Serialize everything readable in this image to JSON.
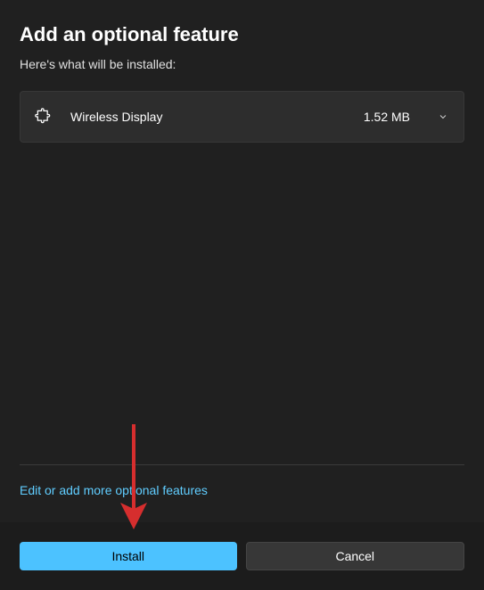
{
  "dialog": {
    "title": "Add an optional feature",
    "subtitle": "Here's what will be installed:"
  },
  "features": [
    {
      "name": "Wireless Display",
      "size": "1.52 MB"
    }
  ],
  "link": {
    "edit_label": "Edit or add more optional features"
  },
  "buttons": {
    "install_label": "Install",
    "cancel_label": "Cancel"
  },
  "colors": {
    "accent": "#4cc2ff",
    "link": "#60cdff",
    "background": "#202020",
    "annotation": "#d62e2e"
  }
}
